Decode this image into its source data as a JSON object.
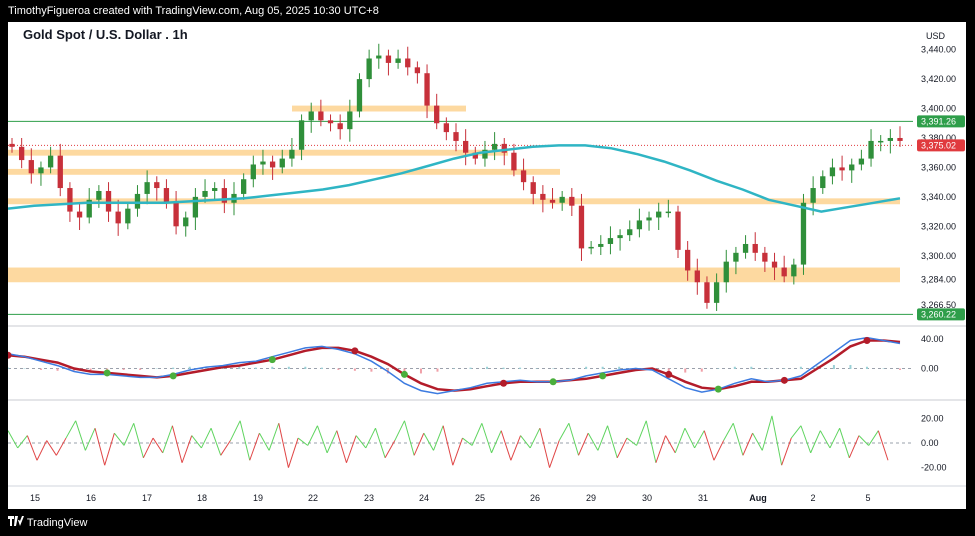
{
  "header": {
    "credit": "TimothyFigueroa created with TradingView.com, Aug 05, 2025 10:30 UTC+8"
  },
  "footer": {
    "brand": "TradingView",
    "logo_icon": "tradingview-logo-icon"
  },
  "colors": {
    "bull": "#2f8f3a",
    "bear": "#c7303a",
    "ma": "#2fb5c4",
    "zone": "#fdd9a0",
    "price_tag": "#e03a3e",
    "level_tag": "#2e9e4a",
    "osc_fast": "#3c7be0",
    "osc_green": "#4aae3c",
    "osc_red": "#b31c2a",
    "rsi_green": "#5fd45f",
    "rsi_red": "#e04646"
  },
  "chart_data": [
    {
      "type": "candlestick",
      "title": "Gold Spot / U.S. Dollar . 1h",
      "currency": "USD",
      "x_labels": [
        "15",
        "16",
        "17",
        "18",
        "19",
        "22",
        "23",
        "24",
        "25",
        "26",
        "29",
        "30",
        "31",
        "Aug",
        "2",
        "5"
      ],
      "y_ticks": [
        "3,440.00",
        "3,420.00",
        "3,400.00",
        "3,380.00",
        "3,360.00",
        "3,340.00",
        "3,320.00",
        "3,300.00",
        "3,284.00",
        "3,266.50"
      ],
      "ylim": [
        3255,
        3452
      ],
      "closes": [
        3374,
        3365,
        3356,
        3360,
        3368,
        3346,
        3330,
        3326,
        3338,
        3344,
        3330,
        3322,
        3332,
        3342,
        3350,
        3346,
        3336,
        3320,
        3326,
        3340,
        3344,
        3346,
        3336,
        3342,
        3352,
        3362,
        3364,
        3360,
        3366,
        3372,
        3392,
        3398,
        3392,
        3390,
        3386,
        3398,
        3420,
        3434,
        3436,
        3431,
        3434,
        3428,
        3424,
        3402,
        3390,
        3384,
        3378,
        3370,
        3366,
        3372,
        3376,
        3370,
        3358,
        3350,
        3342,
        3338,
        3336,
        3340,
        3334,
        3305,
        3306,
        3308,
        3312,
        3314,
        3318,
        3324,
        3326,
        3330,
        3330,
        3304,
        3290,
        3282,
        3268,
        3282,
        3296,
        3302,
        3308,
        3302,
        3296,
        3292,
        3286,
        3294,
        3336,
        3346,
        3354,
        3360,
        3358,
        3362,
        3366,
        3378,
        3378,
        3380,
        3378
      ],
      "ma_values": [
        3332,
        3334,
        3335,
        3336,
        3336,
        3336,
        3336,
        3337,
        3338,
        3339,
        3341,
        3343,
        3345,
        3348,
        3352,
        3356,
        3361,
        3366,
        3370,
        3372,
        3374,
        3375,
        3375,
        3373,
        3369,
        3364,
        3358,
        3351,
        3345,
        3338,
        3334,
        3330,
        3333,
        3336,
        3339
      ],
      "zones": [
        {
          "from": 3398,
          "to": 3402
        },
        {
          "from": 3368,
          "to": 3372
        },
        {
          "from": 3355,
          "to": 3359
        },
        {
          "from": 3335,
          "to": 3339
        },
        {
          "from": 3282,
          "to": 3292
        }
      ],
      "level_lines": [
        {
          "value": 3391.26,
          "label": "3,391.26",
          "kind": "green"
        },
        {
          "value": 3375.02,
          "label": "3,375.02",
          "kind": "current"
        },
        {
          "value": 3260.22,
          "label": "3,260.22",
          "kind": "green"
        }
      ]
    },
    {
      "type": "line",
      "y_ticks": [
        "40.00",
        "0.00"
      ],
      "ylim": [
        -40,
        55
      ],
      "fast": [
        20,
        16,
        10,
        4,
        -4,
        -8,
        -8,
        -10,
        -12,
        -12,
        -8,
        -2,
        2,
        4,
        8,
        10,
        16,
        22,
        28,
        30,
        26,
        20,
        10,
        -4,
        -20,
        -30,
        -34,
        -30,
        -26,
        -20,
        -18,
        -16,
        -18,
        -18,
        -16,
        -10,
        -6,
        -2,
        0,
        -2,
        -14,
        -26,
        -32,
        -28,
        -20,
        -14,
        -18,
        -16,
        -10,
        6,
        22,
        38,
        42,
        38,
        34
      ],
      "slow": [
        18,
        16,
        12,
        8,
        0,
        -4,
        -6,
        -8,
        -10,
        -12,
        -10,
        -6,
        -2,
        2,
        4,
        8,
        12,
        18,
        24,
        28,
        28,
        24,
        16,
        6,
        -8,
        -20,
        -28,
        -30,
        -28,
        -24,
        -20,
        -18,
        -18,
        -18,
        -16,
        -14,
        -10,
        -6,
        -2,
        0,
        -8,
        -18,
        -26,
        -28,
        -24,
        -18,
        -18,
        -16,
        -14,
        0,
        14,
        30,
        38,
        38,
        36
      ]
    },
    {
      "type": "line",
      "y_ticks": [
        "20.00",
        "0.00",
        "-20.00"
      ],
      "ylim": [
        -30,
        30
      ],
      "values": [
        10,
        -4,
        6,
        -14,
        2,
        -10,
        4,
        18,
        -6,
        12,
        -18,
        8,
        -2,
        16,
        -12,
        4,
        -8,
        14,
        -16,
        6,
        -4,
        12,
        -10,
        2,
        18,
        -14,
        8,
        -6,
        16,
        -20,
        4,
        -2,
        14,
        -8,
        10,
        -16,
        6,
        -4,
        12,
        -12,
        2,
        18,
        -10,
        8,
        -6,
        14,
        -18,
        4,
        -2,
        16,
        -8,
        10,
        -14,
        6,
        -4,
        12,
        -20,
        2,
        16,
        -10,
        8,
        -6,
        14,
        -12,
        4,
        -2,
        18,
        -16,
        6,
        -8,
        12,
        -4,
        10,
        -14,
        2,
        16,
        -10,
        8,
        -6,
        22,
        -18,
        4,
        14,
        -8,
        10,
        -4,
        12,
        -12,
        6,
        -2,
        10,
        -14
      ]
    }
  ]
}
